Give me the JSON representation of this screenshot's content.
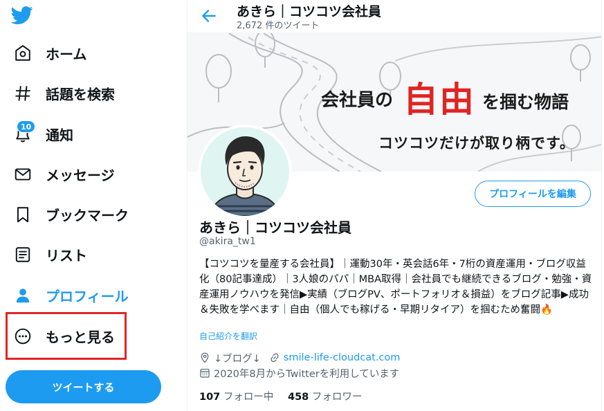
{
  "nav": {
    "items": [
      {
        "label": "ホーム",
        "icon": "home-icon"
      },
      {
        "label": "話題を検索",
        "icon": "hashtag-icon"
      },
      {
        "label": "通知",
        "icon": "bell-icon",
        "badge": "10"
      },
      {
        "label": "メッセージ",
        "icon": "envelope-icon"
      },
      {
        "label": "ブックマーク",
        "icon": "bookmark-icon"
      },
      {
        "label": "リスト",
        "icon": "list-icon"
      },
      {
        "label": "プロフィール",
        "icon": "person-icon"
      },
      {
        "label": "もっと見る",
        "icon": "more-circle-icon"
      }
    ],
    "tweet_button": "ツイートする"
  },
  "header": {
    "title": "あきら｜コツコツ会社員",
    "subtitle": "2,672 件のツイート"
  },
  "banner": {
    "line1": "会社員の",
    "emphasis": "自由",
    "line1b": "を掴む物語",
    "line2": "コツコツだけが取り柄です。"
  },
  "profile": {
    "edit_button": "プロフィールを編集",
    "name": "あきら｜コツコツ会社員",
    "handle": "@akira_tw1",
    "bio": "【コツコツを量産する会社員】｜運動30年・英会話6年・7桁の資産運用・ブログ収益化（80記事達成）｜3人娘のパパ｜MBA取得｜会社員でも継続できるブログ・勉強・資産運用ノウハウを発信▶実績（ブログPV、ポートフォリオ＆損益）をブログ記事▶成功＆失敗を学べます｜自由（個人でも稼げる・早期リタイア）を掴むため奮闘🔥",
    "translate": "自己紹介を翻訳",
    "location": "↓ブログ↓",
    "website": "smile-life-cloudcat.com",
    "joined": "2020年8月からTwitterを利用しています",
    "following_count": "107",
    "following_label": "フォロー中",
    "followers_count": "458",
    "followers_label": "フォロワー"
  },
  "colors": {
    "accent": "#1d9bf0",
    "highlight_box": "#e02424",
    "banner_red": "#e02424"
  }
}
